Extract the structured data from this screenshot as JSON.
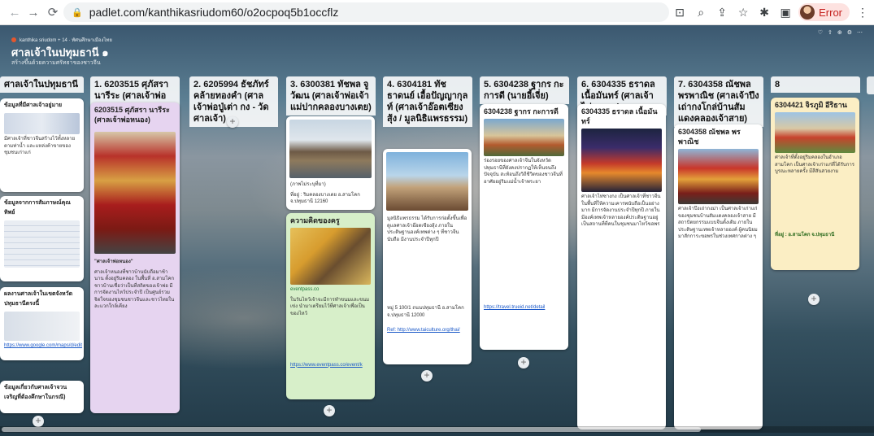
{
  "browser": {
    "url": "padlet.com/kanthikasriudom60/o2ocpoq5b1occflz",
    "profile_label": "Error"
  },
  "padlet": {
    "meta": "kanthika sriudom + 14 · ทัศนศึกษาเมืองไทย",
    "title": "ศาลเจ้าในปทุมธานี ๑",
    "subtitle": "สร้างขึ้นด้วยความศรัทธาของชาวจีน"
  },
  "columns": [
    {
      "title": "ศาลเจ้าในปทุมธานี"
    },
    {
      "title": "1. 6203515 ศุภัสรา นารีระ (ศาลเจ้าพ่อหนอง)"
    },
    {
      "title": "2. 6205994 ธัชภัทร์ คล้ายทองคำ (ศาลเจ้าพ่อปู่เต่า กง - วัดศาลเจ้า)"
    },
    {
      "title": "3. 6300381 ทัชพล จูวัฒน (ศาลเจ้าพ่อเจ้าแม่ปากคลองบางเตย)"
    },
    {
      "title": "4. 6304181 ทัชธาดนย์ เอื้อปัญญากุลท์ (ศาลเจ้าอ๊อตเซียงสุ้ง / มูลนิธิแพรธรรม)"
    },
    {
      "title": "5. 6304238 ฐากร กะการดี (นายอี้เจี่ย)"
    },
    {
      "title": "6. 6304335 ธราดล เนื้อมันทร์ (ศาลเจ้าไท่ซางกง)"
    },
    {
      "title": "7. 6304358 ณัชพล พรพาณิช (ศาลเจ้าปึงเถ่ากงโกล่บ้านสัมแดงคลองเจ้าสาย)"
    },
    {
      "title": "8"
    }
  ],
  "cards": {
    "c0a": {
      "title": "ข้อมูลที่มีศาลเจ้าอยู่มาย",
      "text": "มีศาลเจ้าที่ชาวจีนสร้างไว้ทั้งหลายตามท่าน้ำ และแหล่งค้าขายของชุมชนเก่าแก่"
    },
    "c0b": {
      "title": "ข้อมูลจากการสัมภาษณ์คุณทิพย์",
      "text": ""
    },
    "c0c": {
      "title": "ผลงานศาลเจ้าในเขตจังหวัดปทุมธานีตรงนี้",
      "link": "https://www.google.com/maps/d/edit"
    },
    "c0d": {
      "title": "ข้อมูลเกี่ยวกับศาลเจ้าจวนเจริญที่ต้องคึกษาในกรณี)"
    },
    "c1": {
      "title": "6203515 ศุภัสรา นารีระ (ศาลเจ้าพ่อหนอง)",
      "quote": "\"ศาลเจ้าพ่อหนอง\"",
      "text": "ศาลเจ้าหนองที่ชาวบ้านนับถือมาช้านาน ตั้งอยู่ริมคลอง ในพื้นที่ อ.สามโคก ชาวบ้านเชื่อว่าเป็นที่สถิตของเจ้าพ่อ มีการจัดงานไหว้ประจำปี เป็นศูนย์รวมจิตใจของชุมชนชาวจีนและชาวไทยในละแวกใกล้เคียง"
    },
    "c3a": {
      "caption": "(ภาพไม่ระบุที่มา)",
      "text": "ที่อยู่ : ริมคลองบางเตย อ.สามโคก จ.ปทุมธานี 12160"
    },
    "c3b": {
      "title": "ความคิดของครู",
      "source": "eventpass.co",
      "text": "ในวันไหว้เจ้าจะมีการทำขนมและขนมเข่ง นำมาเตรียมไว้ที่ศาลเจ้าเพื่อเป็นของไหว้",
      "link": "https://www.eventpass.co/event/k"
    },
    "c4": {
      "text": "มูลนิธิแพรธรรม ได้รับการก่อตั้งขึ้นเพื่อดูแลศาลเจ้าอ๊อตเซียงสุ้ง ภายในประดิษฐานองค์เทพต่าง ๆ ที่ชาวจีนนับถือ มีงานประจำปีทุกปี",
      "addr": "หมู่ 5 100/1 ถนนปทุมธานี อ.สามโคก จ.ปทุมธานี 12000",
      "ref": "Ref: http://www.taiculture.org/thai/"
    },
    "c5": {
      "title": "6304238 ฐากร กะการดี",
      "text": "ร่องรอยของศาลเจ้าจีนในจังหวัดปทุมธานีที่ยังคงปรากฏให้เห็นจนถึงปัจจุบัน สะท้อนถึงวิถีชีวิตของชาวจีนที่อาศัยอยู่ริมแม่น้ำเจ้าพระยา",
      "link": "https://travel.trueid.net/detail"
    },
    "c6": {
      "title": "6304335 ธราดล เนื้อมันทร์",
      "text": "ศาลเจ้าไท่ซางกง เป็นศาลเจ้าที่ชาวจีนในพื้นที่ให้ความเคารพนับถือเป็นอย่างมาก มีการจัดงานประจำปีทุกปี ภายในมีองค์เทพเจ้าหลายองค์ประดิษฐานอยู่ เป็นสถานที่ที่คนในชุมชนมาไหว้ขอพร"
    },
    "c7": {
      "title": "6304358 ณัชพล พรพาณิช",
      "text": "ศาลเจ้าปึงเถ่ากงม่า เป็นศาลเจ้าเก่าแก่ของชุมชนบ้านสัมแดงคลองเจ้าสาย มีสถาปัตยกรรมแบบจีนดั้งเดิม ภายในประดิษฐานเทพเจ้าหลายองค์ ผู้คนนิยมมาสักการะขอพรในช่วงเทศกาลต่าง ๆ"
    },
    "c8": {
      "title": "6304421 จิรภูมิ อีริธาน",
      "text": "ศาลเจ้าที่ตั้งอยู่ริมคลองในอำเภอสามโคก เป็นศาลเจ้าเก่าแก่ที่ได้รับการบูรณะหลายครั้ง มีสีสันสวยงาม",
      "footer": "ที่อยู่ : อ.สามโคก จ.ปทุมธานี"
    }
  },
  "icons": {
    "back": "back-arrow-icon",
    "forward": "forward-arrow-icon",
    "reload": "reload-icon"
  }
}
